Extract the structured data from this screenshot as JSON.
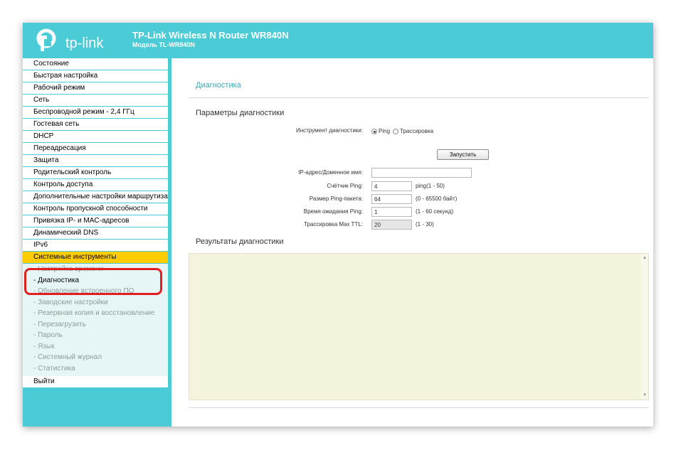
{
  "header": {
    "logo_text": "tp-link",
    "product_title": "TP-Link Wireless N Router WR840N",
    "model_line": "Модель TL-WR840N"
  },
  "sidebar": {
    "items": [
      {
        "label": "Состояние"
      },
      {
        "label": "Быстрая настройка"
      },
      {
        "label": "Рабочий режим"
      },
      {
        "label": "Сеть"
      },
      {
        "label": "Беспроводной режим - 2,4 ГГц"
      },
      {
        "label": "Гостевая сеть"
      },
      {
        "label": "DHCP"
      },
      {
        "label": "Переадресация"
      },
      {
        "label": "Защита"
      },
      {
        "label": "Родительский контроль"
      },
      {
        "label": "Контроль доступа"
      },
      {
        "label": "Дополнительные настройки маршрутизации"
      },
      {
        "label": "Контроль пропускной способности"
      },
      {
        "label": "Привязка IP- и MAC-адресов"
      },
      {
        "label": "Динамический DNS"
      },
      {
        "label": "IPv6"
      },
      {
        "label": "Системные инструменты"
      }
    ],
    "subitems": [
      {
        "label": "- Настройка времени"
      },
      {
        "label": "- Диагностика"
      },
      {
        "label": "- Обновление встроенного ПО"
      },
      {
        "label": "- Заводские настройки"
      },
      {
        "label": "- Резервная копия и восстановление"
      },
      {
        "label": "- Перезагрузить"
      },
      {
        "label": "- Пароль"
      },
      {
        "label": "- Язык"
      },
      {
        "label": "- Системный журнал"
      },
      {
        "label": "- Статистика"
      }
    ],
    "logout": "Выйти"
  },
  "content": {
    "page_title": "Диагностика",
    "params_title": "Параметры диагностики",
    "tool_label": "Инструмент диагностики:",
    "radio_ping": "Ping",
    "radio_trace": "Трассировка",
    "start_button": "Запустить",
    "ip_label": "IP-адрес/Доменное имя:",
    "ip_value": "",
    "count_label": "Счётчик Ping:",
    "count_value": "4",
    "count_hint": "ping(1 - 50)",
    "size_label": "Размер Ping-пакета:",
    "size_value": "64",
    "size_hint": "(0 - 65500 байт)",
    "timeout_label": "Время ожидания Ping:",
    "timeout_value": "1",
    "timeout_hint": "(1 - 60 секунд)",
    "ttl_label": "Трассировка Max TTL:",
    "ttl_value": "20",
    "ttl_hint": "(1 - 30)",
    "results_title": "Результаты диагностики",
    "results_text": ""
  },
  "colors": {
    "accent": "#4acbd6",
    "highlight": "#ffcc00",
    "callout": "#e02020",
    "results_bg": "#f4f4dc"
  }
}
